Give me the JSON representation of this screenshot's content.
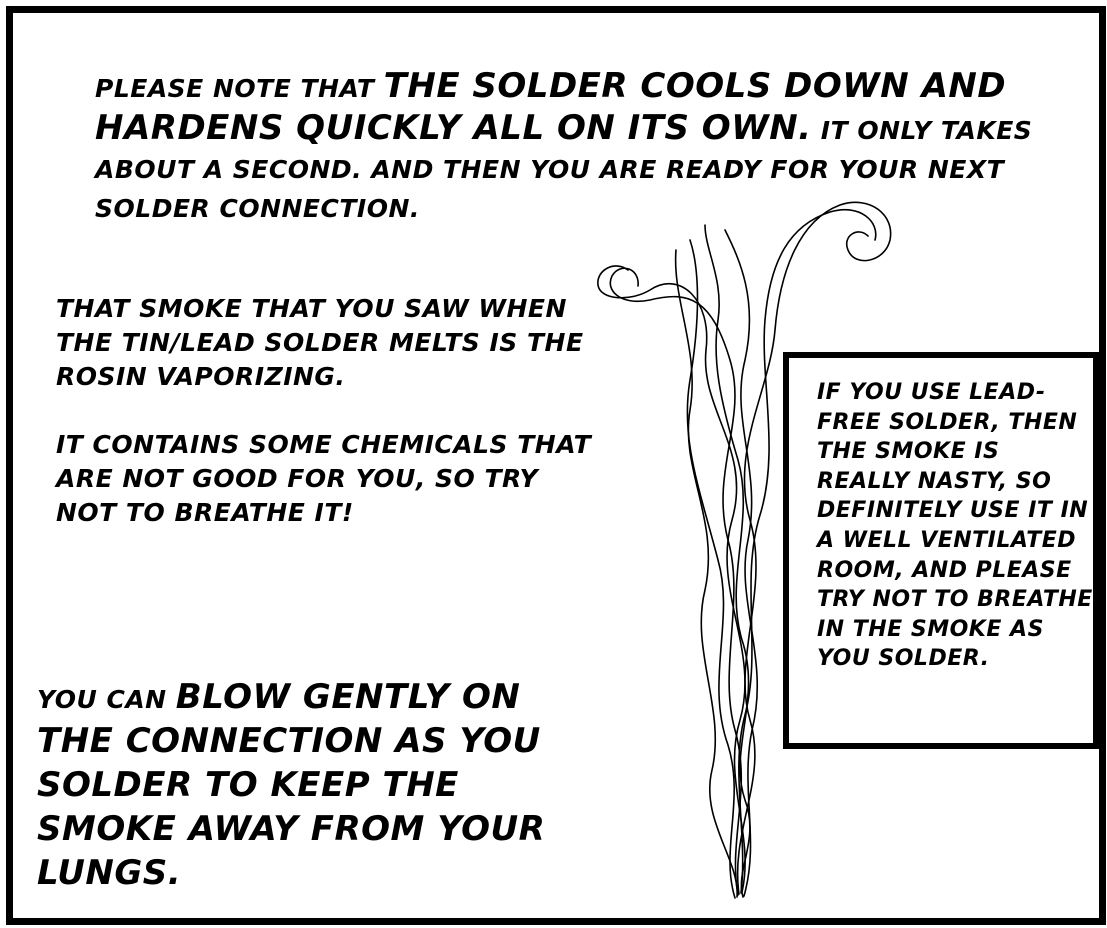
{
  "panel": {
    "top_caption": {
      "lead": "PLEASE NOTE THAT ",
      "emphasis": "THE SOLDER COOLS DOWN AND HARDENS QUICKLY ALL ON ITS OWN.",
      "rest": "  IT ONLY TAKES ABOUT A SECOND.  AND THEN YOU ARE READY FOR YOUR NEXT SOLDER CONNECTION."
    },
    "smoke_caption": {
      "p1": "THAT SMOKE THAT YOU SAW WHEN THE TIN/LEAD SOLDER MELTS IS THE ROSIN VAPORIZING.",
      "p2": "IT CONTAINS SOME CHEMICALS THAT ARE NOT GOOD FOR YOU, SO TRY NOT TO BREATHE IT!"
    },
    "blow_caption": {
      "lead": "YOU CAN ",
      "emphasis": "BLOW GENTLY ON THE CONNECTION AS YOU SOLDER TO KEEP THE SMOKE AWAY FROM YOUR LUNGS."
    },
    "lead_free_box": {
      "text": "IF YOU USE LEAD-FREE SOLDER, THEN THE SMOKE IS REALLY NASTY, SO DEFINITELY USE IT IN A WELL VENTILATED ROOM, AND PLEASE TRY NOT TO BREATHE IN THE SMOKE AS YOU SOLDER."
    },
    "colors": {
      "ink": "#000000",
      "paper": "#ffffff"
    },
    "illustration": "rising-smoke-wisps"
  }
}
